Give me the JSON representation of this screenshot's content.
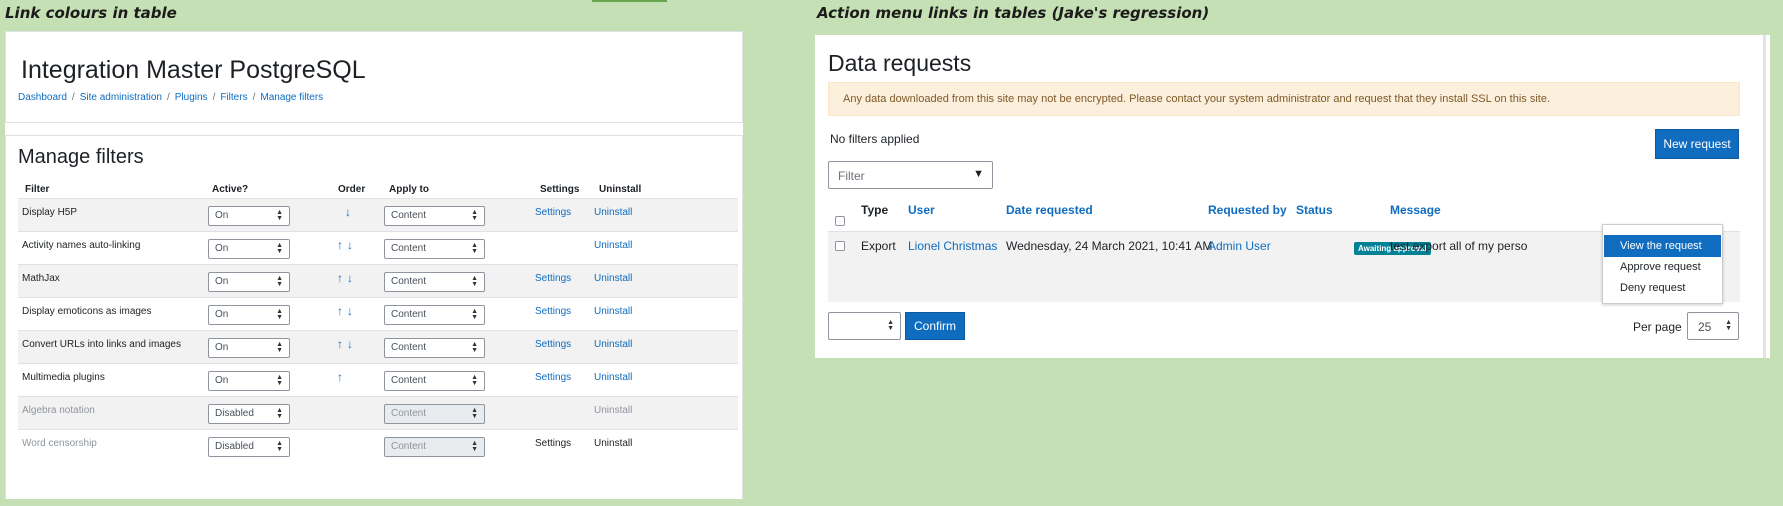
{
  "captions": {
    "left": "Link colours in table",
    "right": "Action menu links in tables (Jake's regression)"
  },
  "left_panel": {
    "site_title": "Integration Master PostgreSQL",
    "breadcrumbs": [
      "Dashboard",
      "Site administration",
      "Plugins",
      "Filters",
      "Manage filters"
    ],
    "breadcrumb_separator": "/",
    "page_title": "Manage filters",
    "columns": [
      "Filter",
      "Active?",
      "Order",
      "Apply to",
      "Settings",
      "Uninstall"
    ],
    "rows": [
      {
        "filter": "Display H5P",
        "active": "On",
        "order": [
          "down"
        ],
        "apply_to": "Content",
        "settings": "Settings",
        "uninstall": "Uninstall",
        "disabled": false
      },
      {
        "filter": "Activity names auto-linking",
        "active": "On",
        "order": [
          "up",
          "down"
        ],
        "apply_to": "Content",
        "settings": "",
        "uninstall": "Uninstall",
        "disabled": false
      },
      {
        "filter": "MathJax",
        "active": "On",
        "order": [
          "up",
          "down"
        ],
        "apply_to": "Content",
        "settings": "Settings",
        "uninstall": "Uninstall",
        "disabled": false
      },
      {
        "filter": "Display emoticons as images",
        "active": "On",
        "order": [
          "up",
          "down"
        ],
        "apply_to": "Content",
        "settings": "Settings",
        "uninstall": "Uninstall",
        "disabled": false
      },
      {
        "filter": "Convert URLs into links and images",
        "active": "On",
        "order": [
          "up",
          "down"
        ],
        "apply_to": "Content",
        "settings": "Settings",
        "uninstall": "Uninstall",
        "disabled": false
      },
      {
        "filter": "Multimedia plugins",
        "active": "On",
        "order": [
          "up"
        ],
        "apply_to": "Content",
        "settings": "Settings",
        "uninstall": "Uninstall",
        "disabled": false
      },
      {
        "filter": "Algebra notation",
        "active": "Disabled",
        "order": [],
        "apply_to": "Content",
        "settings": "",
        "uninstall": "Uninstall",
        "disabled": true
      },
      {
        "filter": "Word censorship",
        "active": "Disabled",
        "order": [],
        "apply_to": "Content",
        "settings": "Settings",
        "uninstall": "Uninstall",
        "disabled": true
      }
    ]
  },
  "right_panel": {
    "title": "Data requests",
    "alert": "Any data downloaded from this site may not be encrypted. Please contact your system administrator and request that they install SSL on this site.",
    "no_filters": "No filters applied",
    "new_request": "New request",
    "filter_placeholder": "Filter",
    "columns": [
      "Type",
      "User",
      "Date requested",
      "Requested by",
      "Status",
      "Message"
    ],
    "row": {
      "type": "Export",
      "user": "Lionel Christmas",
      "date": "Wednesday, 24 March 2021, 10:41 AM",
      "requested_by": "Admin User",
      "status": "Awaiting approval",
      "message": "test export all of my perso"
    },
    "action_menu": [
      "View the request",
      "Approve request",
      "Deny request"
    ],
    "confirm": "Confirm",
    "per_page_label": "Per page",
    "per_page_value": "25"
  },
  "colors": {
    "background": "#c5e0b4",
    "link": "#0f6cbf",
    "alert_bg": "#fcefdc",
    "badge": "#008196"
  },
  "icons": {
    "order_up": "arrow-up-icon",
    "order_down": "arrow-down-icon",
    "select_caret": "up-down-caret-icon",
    "filter_dropdown": "triangle-down-icon"
  }
}
